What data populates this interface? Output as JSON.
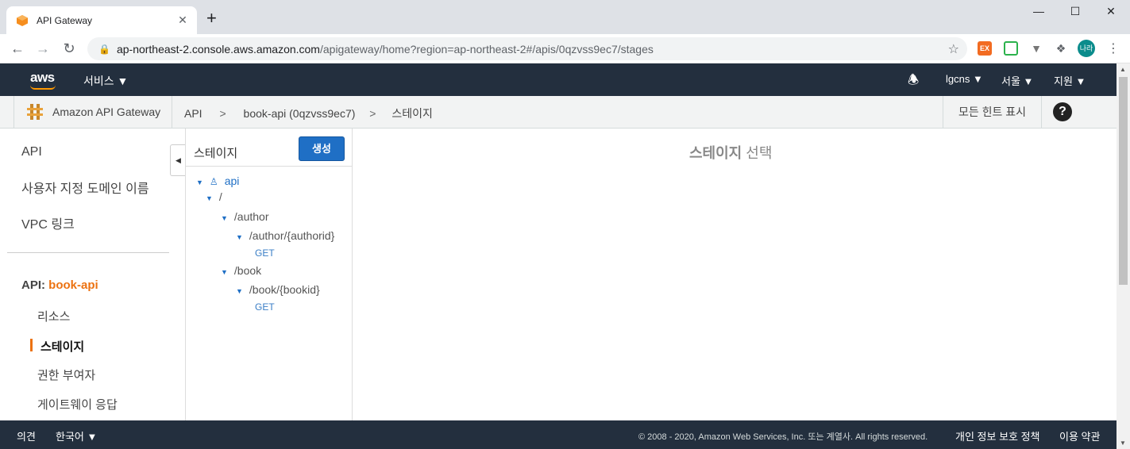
{
  "browser": {
    "tab_title": "API Gateway",
    "tab_close": "✕",
    "new_tab": "+",
    "url_host": "ap-northeast-2.console.aws.amazon.com",
    "url_path": "/apigateway/home?region=ap-northeast-2#/apis/0qzvss9ec7/stages",
    "profile_initials": "나라",
    "ext_1_label": "EX"
  },
  "aws_nav": {
    "logo": "aws",
    "services": "서비스 ▼",
    "account": "lgcns ▼",
    "region": "서울 ▼",
    "support": "지원 ▼"
  },
  "subnav": {
    "service_name": "Amazon API Gateway",
    "breadcrumbs": [
      "API",
      ">",
      "book-api (0qzvss9ec7)",
      ">",
      "스테이지"
    ],
    "hints": "모든 힌트 표시",
    "help": "?"
  },
  "leftnav": {
    "items": [
      "API",
      "사용자 지정 도메인 이름",
      "VPC 링크"
    ],
    "api_prefix": "API:",
    "api_name": "book-api",
    "sub_items": [
      "리소스",
      "스테이지",
      "권한 부여자",
      "게이트웨이 응답"
    ]
  },
  "stages": {
    "title": "스테이지",
    "create_button": "생성",
    "tree": {
      "stage": "api",
      "root": "/",
      "author": "/author",
      "author_id": "/author/{authorid}",
      "author_method": "GET",
      "book": "/book",
      "book_id": "/book/{bookid}",
      "book_method": "GET"
    }
  },
  "main": {
    "title_bold": "스테이지",
    "title_rest": "선택"
  },
  "footer": {
    "feedback": "의견",
    "language": "한국어 ▼",
    "copyright": "© 2008 - 2020, Amazon Web Services, Inc. 또는 계열사. All rights reserved.",
    "privacy": "개인 정보 보호 정책",
    "terms": "이용 약관"
  },
  "colors": {
    "aws_nav_bg": "#232f3e",
    "accent_orange": "#ec7211",
    "primary_blue": "#1f6fc5"
  }
}
